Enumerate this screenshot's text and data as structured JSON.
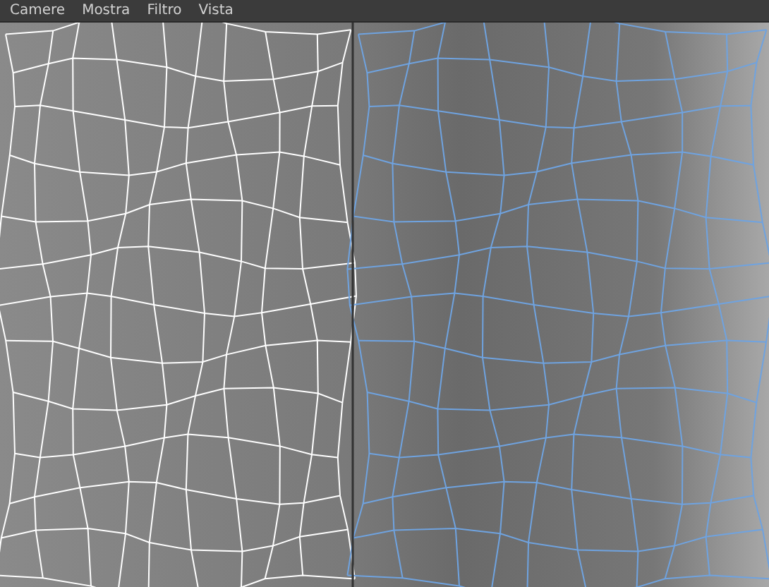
{
  "menu_bar": {
    "items": [
      "Camere",
      "Mostra",
      "Filtro",
      "Vista"
    ]
  }
}
